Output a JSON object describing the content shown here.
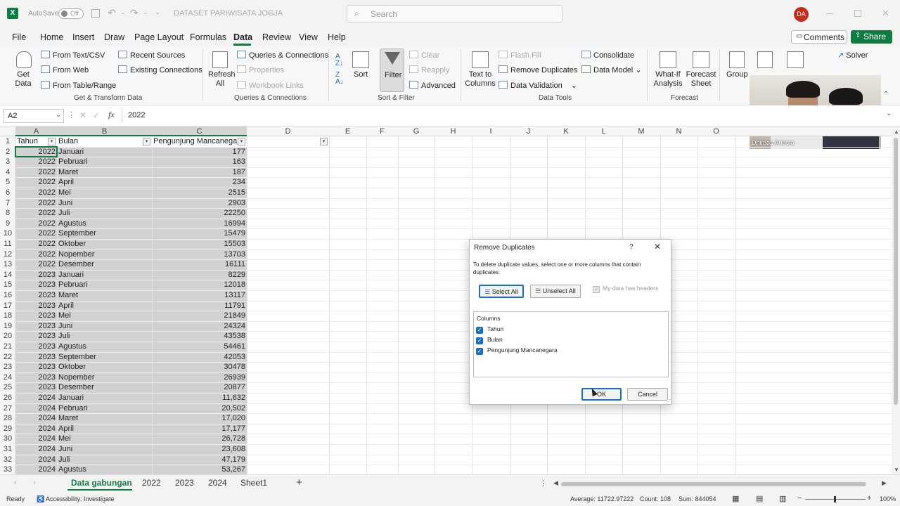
{
  "titlebar": {
    "autosave_label": "AutoSave",
    "autosave_state": "Off",
    "doc_title": "DATASET PARIWISATA JOGJA",
    "search_placeholder": "Search",
    "user_initials": "DA"
  },
  "menu": [
    "File",
    "Home",
    "Insert",
    "Draw",
    "Page Layout",
    "Formulas",
    "Data",
    "Review",
    "View",
    "Help"
  ],
  "menu_active": "Data",
  "comments_label": "Comments",
  "share_label": "Share",
  "ribbon": {
    "get_data": "Get Data",
    "from_text_csv": "From Text/CSV",
    "from_web": "From Web",
    "from_table": "From Table/Range",
    "recent_sources": "Recent Sources",
    "existing_connections": "Existing Connections",
    "group_get_transform": "Get & Transform Data",
    "refresh_all": "Refresh All",
    "queries_connections": "Queries & Connections",
    "properties": "Properties",
    "workbook_links": "Workbook Links",
    "group_queries": "Queries & Connections",
    "sort": "Sort",
    "filter": "Filter",
    "clear": "Clear",
    "reapply": "Reapply",
    "advanced": "Advanced",
    "group_sort_filter": "Sort & Filter",
    "text_to_columns": "Text to Columns",
    "flash_fill": "Flash Fill",
    "remove_duplicates": "Remove Duplicates",
    "data_validation": "Data Validation",
    "consolidate": "Consolidate",
    "data_model": "Data Model",
    "group_data_tools": "Data Tools",
    "what_if": "What-If Analysis",
    "forecast_sheet": "Forecast Sheet",
    "group_forecast": "Forecast",
    "group": "Group",
    "ungroup": "Ungroup",
    "subtotal": "Subtotal",
    "solver": "Solver"
  },
  "formula": {
    "name_box": "A2",
    "fx": "fx",
    "value": "2022"
  },
  "columns": [
    "A",
    "B",
    "C",
    "D",
    "E",
    "F",
    "G",
    "H",
    "I",
    "J",
    "K",
    "L",
    "M",
    "N",
    "O"
  ],
  "header_row": [
    "Tahun",
    "Bulan",
    "Pengunjung Mancanegara"
  ],
  "rows": [
    [
      "2022",
      "Januari",
      "177"
    ],
    [
      "2022",
      "Pebruari",
      "163"
    ],
    [
      "2022",
      "Maret",
      "187"
    ],
    [
      "2022",
      "April",
      "234"
    ],
    [
      "2022",
      "Mei",
      "2515"
    ],
    [
      "2022",
      "Juni",
      "2903"
    ],
    [
      "2022",
      "Juli",
      "22250"
    ],
    [
      "2022",
      "Agustus",
      "16994"
    ],
    [
      "2022",
      "September",
      "15479"
    ],
    [
      "2022",
      "Oktober",
      "15503"
    ],
    [
      "2022",
      "Nopember",
      "13703"
    ],
    [
      "2022",
      "Desember",
      "16111"
    ],
    [
      "2023",
      "Januari",
      "8229"
    ],
    [
      "2023",
      "Pebruari",
      "12018"
    ],
    [
      "2023",
      "Maret",
      "13117"
    ],
    [
      "2023",
      "April",
      "11791"
    ],
    [
      "2023",
      "Mei",
      "21849"
    ],
    [
      "2023",
      "Juni",
      "24324"
    ],
    [
      "2023",
      "Juli",
      "43538"
    ],
    [
      "2023",
      "Agustus",
      "54461"
    ],
    [
      "2023",
      "September",
      "42053"
    ],
    [
      "2023",
      "Oktober",
      "30478"
    ],
    [
      "2023",
      "Nopember",
      "26939"
    ],
    [
      "2023",
      "Desember",
      "20877"
    ],
    [
      "2024",
      "Januari",
      "11,632"
    ],
    [
      "2024",
      "Pebruari",
      "20,502"
    ],
    [
      "2024",
      "Maret",
      "17,020"
    ],
    [
      "2024",
      "April",
      "17,177"
    ],
    [
      "2024",
      "Mei",
      "26,728"
    ],
    [
      "2024",
      "Juni",
      "23,608"
    ],
    [
      "2024",
      "Juli",
      "47,179"
    ],
    [
      "2024",
      "Agustus",
      "53,267"
    ]
  ],
  "dialog": {
    "title": "Remove Duplicates",
    "help": "?",
    "description": "To delete duplicate values, select one or more columns that contain duplicates.",
    "select_all": "Select All",
    "unselect_all": "Unselect All",
    "has_headers": "My data has headers",
    "columns_label": "Columns",
    "column_items": [
      "Tahun",
      "Bulan",
      "Pengunjung Mancanegara"
    ],
    "ok": "OK",
    "cancel": "Cancel"
  },
  "video": {
    "name": "Dhimas Ariesta"
  },
  "sheets": [
    "Data gabungan",
    "2022",
    "2023",
    "2024",
    "Sheet1"
  ],
  "active_sheet": "Data gabungan",
  "status": {
    "ready": "Ready",
    "accessibility": "Accessibility: Investigate",
    "average": "Average: 11722.97222",
    "count": "Count: 108",
    "sum": "Sum: 844054",
    "zoom": "100%"
  },
  "colors": {
    "excel_green": "#107c41",
    "selection_fill": "#d2d2d2",
    "accent_blue": "#1a6dc2"
  }
}
